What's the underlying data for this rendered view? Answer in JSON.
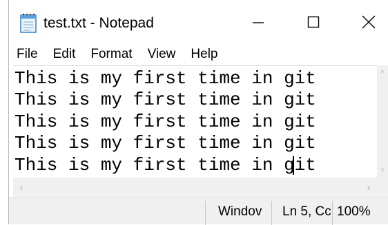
{
  "window": {
    "title": "test.txt - Notepad",
    "icon": "notepad-icon",
    "controls": {
      "minimize": "minimize-icon",
      "maximize": "maximize-icon",
      "close": "close-icon"
    }
  },
  "menu": {
    "items": [
      {
        "label": "File"
      },
      {
        "label": "Edit"
      },
      {
        "label": "Format"
      },
      {
        "label": "View"
      },
      {
        "label": "Help"
      }
    ]
  },
  "editor": {
    "lines": [
      "This is my first time in git",
      "This is my first time in git",
      "This is my first time in git",
      "This is my first time in git",
      "This is my first time in git"
    ]
  },
  "statusbar": {
    "line_ending": "Windov",
    "position": "Ln 5, Cc",
    "zoom": "100%"
  },
  "colors": {
    "background": "#ffffff",
    "chrome": "#f0f0f0",
    "text": "#000000"
  }
}
